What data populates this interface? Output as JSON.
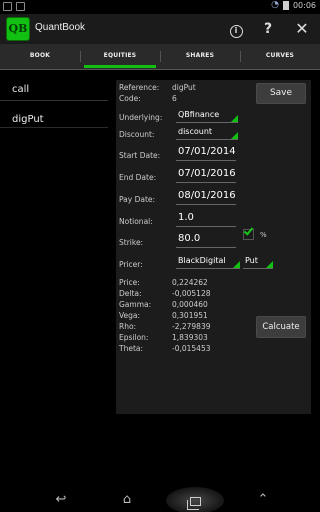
{
  "status_bar": {
    "time": "00:06"
  },
  "app": {
    "title": "QuantBook",
    "logo_text": "QB"
  },
  "action_bar": {
    "info_icon": "info-icon",
    "help_label": "?",
    "close_label": "✕"
  },
  "tabs": [
    {
      "label": "BOOK",
      "active": false
    },
    {
      "label": "EQUITIES",
      "active": true
    },
    {
      "label": "SHARES",
      "active": false
    },
    {
      "label": "CURVES",
      "active": false
    }
  ],
  "list": {
    "items": [
      "call",
      "digPut"
    ]
  },
  "form": {
    "reference_label": "Reference:",
    "reference_value": "digPut",
    "code_label": "Code:",
    "code_value": "6",
    "underlying_label": "Underlying:",
    "underlying_value": "QBfinance",
    "discount_label": "Discount:",
    "discount_value": "discount",
    "start_date_label": "Start Date:",
    "start_date_value": "07/01/2014",
    "end_date_label": "End Date:",
    "end_date_value": "07/01/2016",
    "pay_date_label": "Pay Date:",
    "pay_date_value": "08/01/2016",
    "notional_label": "Notional:",
    "notional_value": "1.0",
    "strike_label": "Strike:",
    "strike_value": "80.0",
    "strike_percent_checked": true,
    "percent_label": "%",
    "pricer_label": "Pricer:",
    "pricer_value": "BlackDigital",
    "option_type_value": "Put",
    "save_label": "Save",
    "calculate_label": "Calcuate"
  },
  "results": [
    {
      "label": "Price:",
      "value": "0,224262"
    },
    {
      "label": "Delta:",
      "value": "-0,005128"
    },
    {
      "label": "Gamma:",
      "value": "0,000460"
    },
    {
      "label": "Vega:",
      "value": "0,301951"
    },
    {
      "label": "Rho:",
      "value": "-2,279839"
    },
    {
      "label": "Epsilon:",
      "value": "1,839303"
    },
    {
      "label": "Theta:",
      "value": "-0,015453"
    }
  ],
  "colors": {
    "accent": "#12c012",
    "background": "#000000",
    "panel": "#1c1c1c"
  }
}
